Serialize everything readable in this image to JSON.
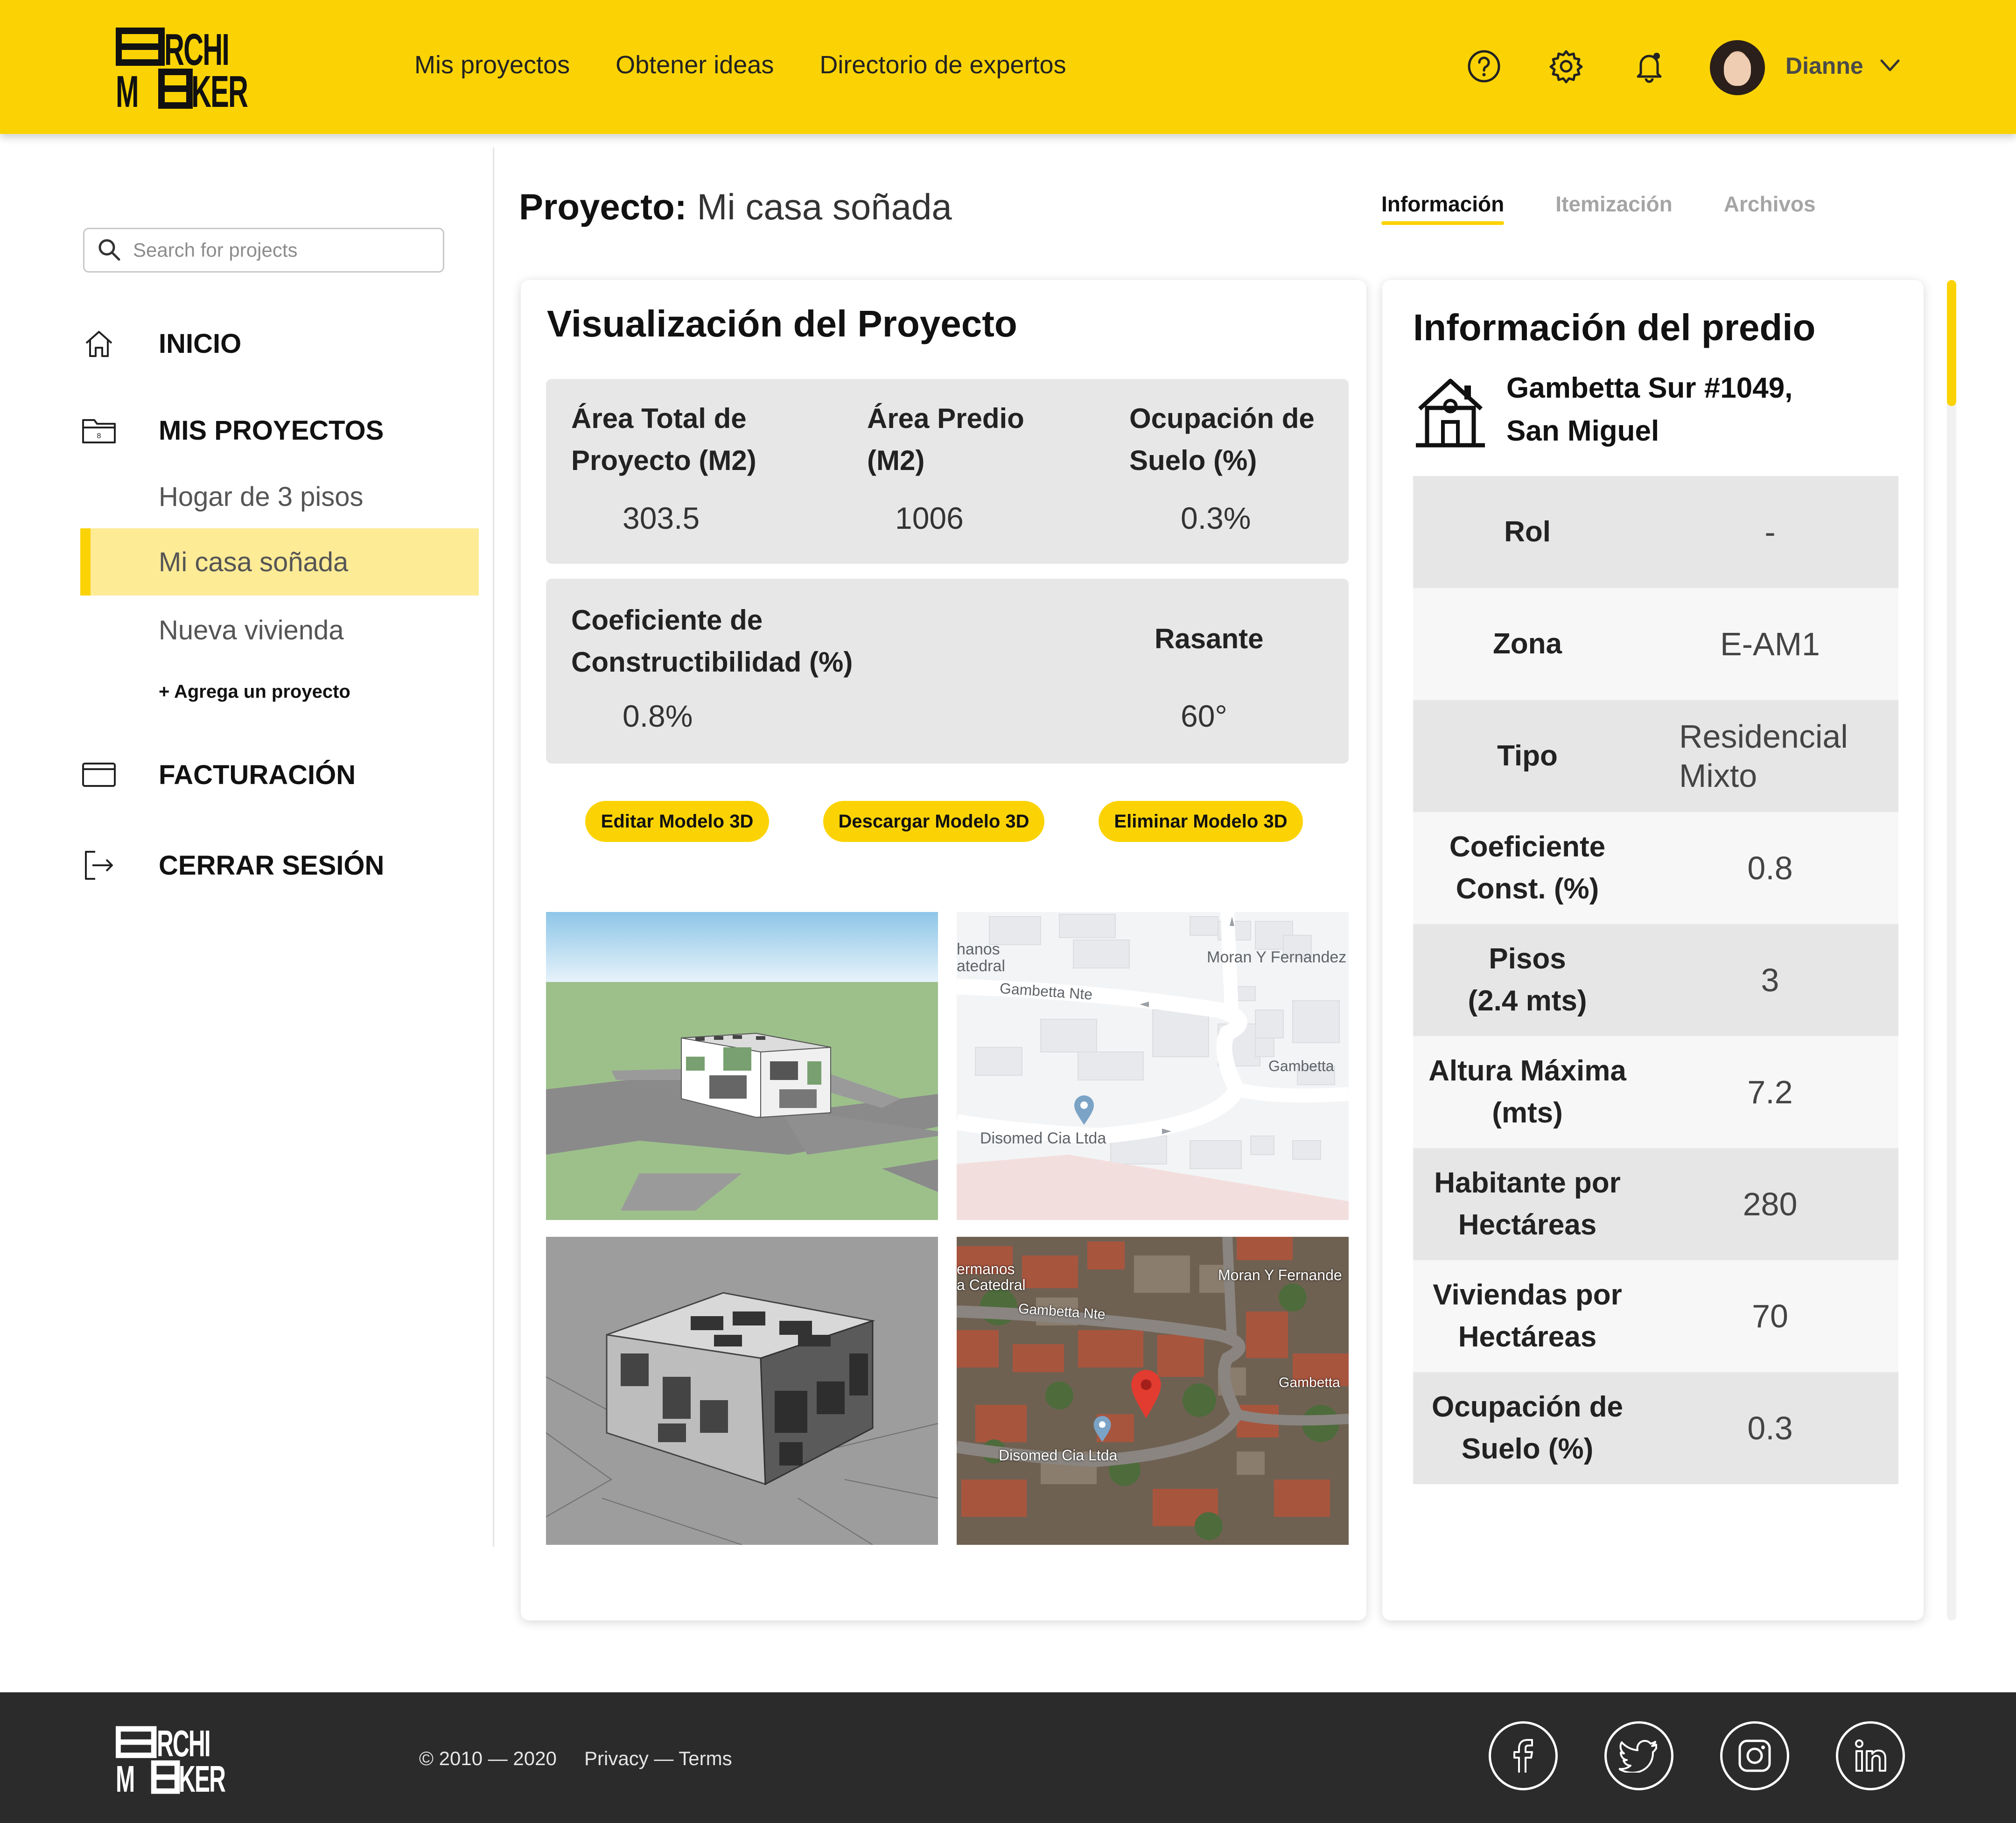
{
  "brand": {
    "logo_line1": "RCHI",
    "logo_line2": "KER"
  },
  "nav": {
    "items": [
      "Mis proyectos",
      "Obtener ideas",
      "Directorio de expertos"
    ]
  },
  "header_icons": [
    "help-icon",
    "gear-icon",
    "bell-icon"
  ],
  "user": {
    "name": "Dianne"
  },
  "sidebar": {
    "search_placeholder": "Search for projects",
    "inicio": "INICIO",
    "mis_proyectos": "MIS PROYECTOS",
    "projects": [
      "Hogar de 3 pisos",
      "Mi casa soñada",
      "Nueva vivienda"
    ],
    "active_project": "Mi casa soñada",
    "add_project": "+ Agrega un proyecto",
    "facturacion": "FACTURACIÓN",
    "cerrar_sesion": "CERRAR SESIÓN"
  },
  "project": {
    "label": "Proyecto:",
    "name": "Mi casa soñada"
  },
  "tabs": [
    {
      "label": "Información",
      "active": true
    },
    {
      "label": "Itemización",
      "active": false
    },
    {
      "label": "Archivos",
      "active": false
    }
  ],
  "visualizacion": {
    "title": "Visualización del Proyecto",
    "stats1": [
      {
        "label_l1": "Área Total de",
        "label_l2": "Proyecto (M2)",
        "value": "303.5"
      },
      {
        "label_l1": "Área Predio",
        "label_l2": "(M2)",
        "value": "1006"
      },
      {
        "label_l1": "Ocupación de",
        "label_l2": "Suelo (%)",
        "value": "0.3%"
      }
    ],
    "stats2": [
      {
        "label_l1": "Coeficiente de",
        "label_l2": "Constructibilidad (%)",
        "value": "0.8%"
      },
      {
        "label_l1": "Rasante",
        "label_l2": "",
        "value": "60°"
      }
    ],
    "buttons": [
      "Editar Modelo 3D",
      "Descargar Modelo 3D",
      "Eliminar Modelo 3D"
    ],
    "map_labels": {
      "hermanos": "hanos",
      "catedral": "atedral",
      "moran": "Moran Y Fernandez",
      "gambetta_nte": "Gambetta Nte",
      "gambetta": "Gambetta",
      "disomed": "Disomed Cia Ltda",
      "sat_hermanos": "ermanos",
      "sat_catedral": "a Catedral",
      "sat_moran": "Moran Y Fernande",
      "sat_gambetta_nte": "Gambetta Nte",
      "sat_gambetta": "Gambetta",
      "sat_disomed": "Disomed Cia Ltda"
    }
  },
  "predio": {
    "title": "Información del predio",
    "address_l1": "Gambetta Sur #1049,",
    "address_l2": "San Miguel",
    "rows": [
      {
        "key_l1": "Rol",
        "key_l2": "",
        "val_l1": "-",
        "val_l2": ""
      },
      {
        "key_l1": "Zona",
        "key_l2": "",
        "val_l1": "E-AM1",
        "val_l2": ""
      },
      {
        "key_l1": "Tipo",
        "key_l2": "",
        "val_l1": "Residencial",
        "val_l2": "Mixto"
      },
      {
        "key_l1": "Coeficiente",
        "key_l2": "Const. (%)",
        "val_l1": "0.8",
        "val_l2": ""
      },
      {
        "key_l1": "Pisos",
        "key_l2": "(2.4 mts)",
        "val_l1": "3",
        "val_l2": ""
      },
      {
        "key_l1": "Altura Máxima",
        "key_l2": "(mts)",
        "val_l1": "7.2",
        "val_l2": ""
      },
      {
        "key_l1": "Habitante por",
        "key_l2": "Hectáreas",
        "val_l1": "280",
        "val_l2": ""
      },
      {
        "key_l1": "Viviendas por",
        "key_l2": "Hectáreas",
        "val_l1": "70",
        "val_l2": ""
      },
      {
        "key_l1": "Ocupación de",
        "key_l2": "Suelo (%)",
        "val_l1": "0.3",
        "val_l2": ""
      }
    ]
  },
  "footer": {
    "copyright": "© 2010 — 2020",
    "links": "Privacy — Terms",
    "social": [
      "facebook-icon",
      "twitter-icon",
      "instagram-icon",
      "linkedin-icon"
    ]
  },
  "colors": {
    "brand_yellow": "#FBD304",
    "active_bg": "#FDEB96",
    "footer_bg": "#2b2b2b"
  }
}
